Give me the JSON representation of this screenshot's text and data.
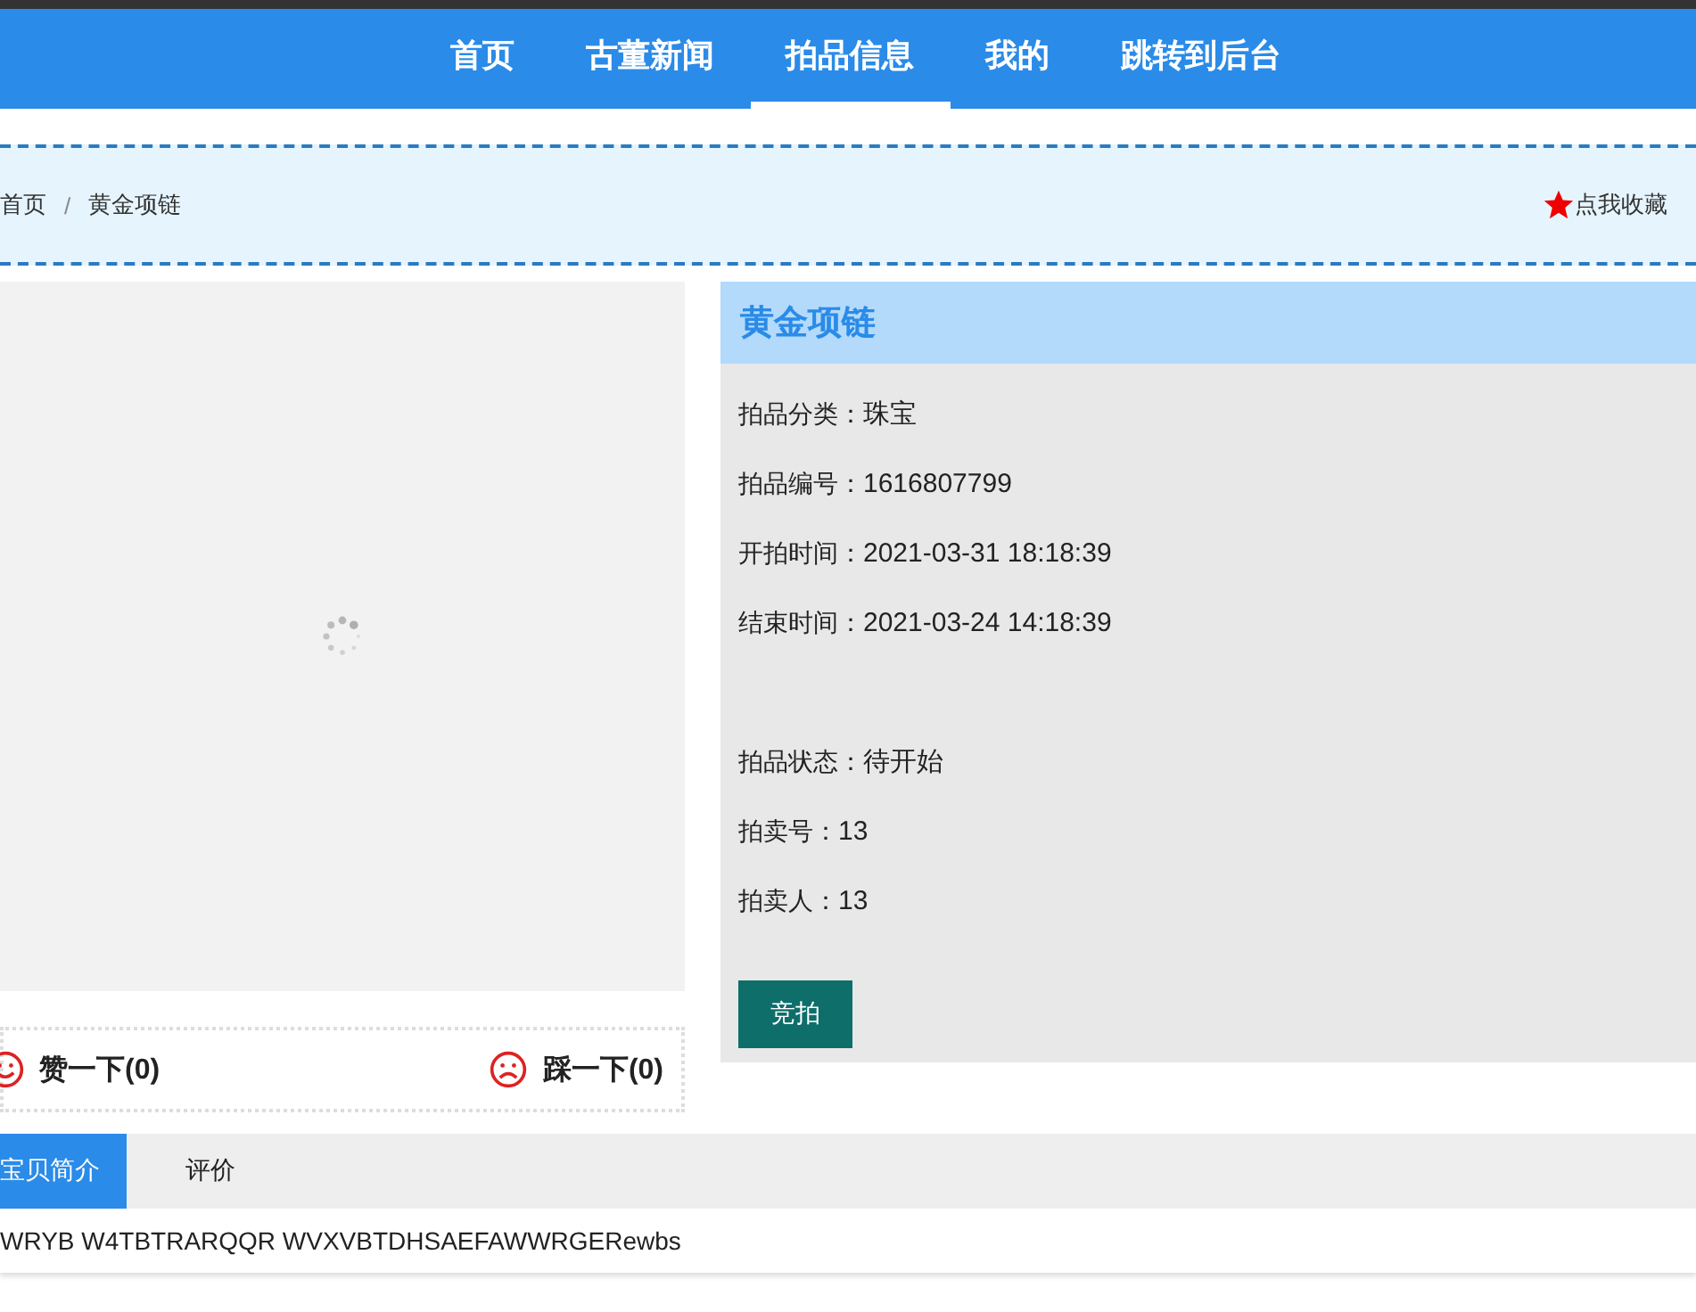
{
  "nav": [
    {
      "label": "首页",
      "selected": false
    },
    {
      "label": "古董新闻",
      "selected": false
    },
    {
      "label": "拍品信息",
      "selected": true
    },
    {
      "label": "我的",
      "selected": false
    },
    {
      "label": "跳转到后台",
      "selected": false
    }
  ],
  "breadcrumb": [
    "首页",
    "黄金项链"
  ],
  "breadcrumb_separator": "/",
  "favorite": "点我收藏",
  "product": {
    "title": "黄金项链",
    "fields": [
      {
        "label": "拍品分类：",
        "value": "珠宝"
      },
      {
        "label": "拍品编号：",
        "value": "1616807799"
      },
      {
        "label": "开拍时间：",
        "value": "2021-03-31 18:18:39"
      },
      {
        "label": "结束时间：",
        "value": "2021-03-24 14:18:39"
      },
      {
        "label": "拍品状态：",
        "value": "待开始"
      },
      {
        "label": "拍卖号：",
        "value": "13"
      },
      {
        "label": "拍卖人：",
        "value": "13"
      }
    ],
    "bid_button": "竞拍"
  },
  "votes": [
    {
      "kind": "like",
      "text": "赞一下(0)"
    },
    {
      "kind": "dislike",
      "text": "踩一下(0)"
    }
  ],
  "tabs": [
    {
      "label": "宝贝简介",
      "selected": true
    },
    {
      "label": "评价",
      "selected": false
    }
  ],
  "description": "WRYB W4TBTRARQQR WVXVBTDHSAEFAWWRGERewbs"
}
